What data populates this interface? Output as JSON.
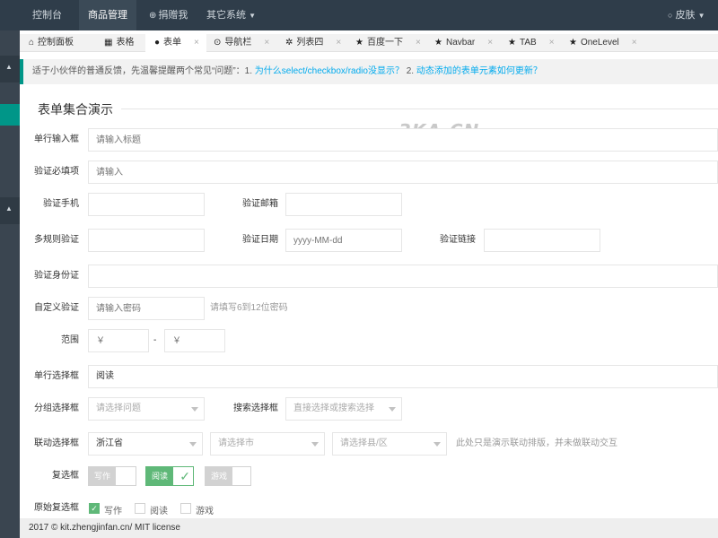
{
  "topnav": {
    "items": [
      "控制台",
      "商品管理",
      "捐赠我",
      "其它系统"
    ],
    "right": "皮肤"
  },
  "tabs": [
    "控制面板",
    "表格",
    "表单",
    "导航栏",
    "列表四",
    "百度一下",
    "Navbar",
    "TAB",
    "OneLevel"
  ],
  "notice": {
    "text": "适于小伙伴的普通反馈，先温馨提醒两个常见“问题”：1.",
    "link1": "为什么select/checkbox/radio没显示？",
    "mid": "2.",
    "link2": "动态添加的表单元素如何更新？"
  },
  "form": {
    "title": "表单集合演示",
    "watermark": "3KA.CN",
    "labels": {
      "single_line": "单行输入框",
      "required": "验证必填项",
      "phone": "验证手机",
      "email": "验证邮箱",
      "multi_rule": "多规则验证",
      "date": "验证日期",
      "link": "验证链接",
      "id_card": "验证身份证",
      "custom": "自定义验证",
      "range": "范围",
      "single_select": "单行选择框",
      "group_select": "分组选择框",
      "search_select": "搜索选择框",
      "linked_select": "联动选择框",
      "checkbox": "复选框",
      "raw_checkbox": "原始复选框"
    },
    "placeholders": {
      "title": "请输入标题",
      "required": "请输入",
      "date": "yyyy-MM-dd",
      "password": "请输入密码",
      "range_min": "￥",
      "range_max": "￥",
      "group_select": "请选择问题",
      "search_select": "直接选择或搜索选择",
      "city": "请选择市",
      "county": "请选择县/区"
    },
    "range_sep": "-",
    "password_hint": "请填写6到12位密码",
    "single_select_value": "阅读",
    "province_value": "浙江省",
    "linked_hint": "此处只是演示联动排版，并未做联动交互",
    "checkboxes": [
      "写作",
      "阅读",
      "游戏"
    ],
    "raw_checkboxes": [
      "写作",
      "阅读",
      "游戏"
    ]
  },
  "footer": {
    "text": "2017 © kit.zhengjinfan.cn/ MIT license"
  },
  "colors": {
    "topbar": "#2f3d4a",
    "accent": "#009688",
    "link": "#01aaed",
    "checked": "#5fb878"
  }
}
